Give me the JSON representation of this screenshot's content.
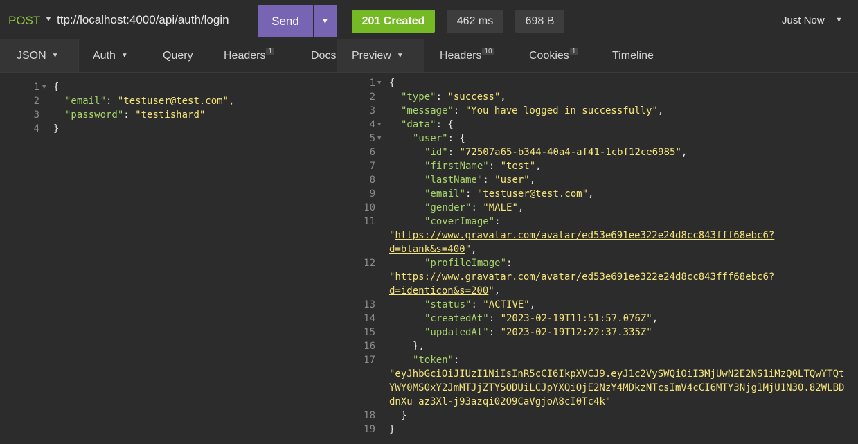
{
  "request": {
    "method": "POST",
    "url": "ttp://localhost:4000/api/auth/login",
    "send_label": "Send"
  },
  "response_meta": {
    "status": "201 Created",
    "time": "462 ms",
    "size": "698 B",
    "history_label": "Just Now"
  },
  "request_tabs": [
    {
      "label": "JSON"
    },
    {
      "label": "Auth"
    },
    {
      "label": "Query"
    },
    {
      "label": "Headers",
      "badge": "1"
    },
    {
      "label": "Docs"
    }
  ],
  "response_tabs": [
    {
      "label": "Preview"
    },
    {
      "label": "Headers",
      "badge": "10"
    },
    {
      "label": "Cookies",
      "badge": "1"
    },
    {
      "label": "Timeline"
    }
  ],
  "request_body": {
    "line_numbers": [
      "1",
      "2",
      "3",
      "4"
    ],
    "open": "{",
    "email_key": "\"email\"",
    "email_val": "\"testuser@test.com\"",
    "password_key": "\"password\"",
    "password_val": "\"testishard\"",
    "close": "}"
  },
  "response_body": {
    "line_numbers": [
      "1",
      "2",
      "3",
      "4",
      "5",
      "6",
      "7",
      "8",
      "9",
      "10",
      "11",
      "12",
      "13",
      "14",
      "15",
      "16",
      "17",
      "18",
      "19"
    ],
    "type_key": "\"type\"",
    "type_val": "\"success\"",
    "message_key": "\"message\"",
    "message_val": "\"You have logged in successfully\"",
    "data_key": "\"data\"",
    "user_key": "\"user\"",
    "id_key": "\"id\"",
    "id_val": "\"72507a65-b344-40a4-af41-1cbf12ce6985\"",
    "firstName_key": "\"firstName\"",
    "firstName_val": "\"test\"",
    "lastName_key": "\"lastName\"",
    "lastName_val": "\"user\"",
    "email_key": "\"email\"",
    "email_val": "\"testuser@test.com\"",
    "gender_key": "\"gender\"",
    "gender_val": "\"MALE\"",
    "coverImage_key": "\"coverImage\"",
    "coverImage_url_1": "https://www.gravatar.com/avatar/ed53e691ee322e24d8cc843fff68ebc6?",
    "coverImage_url_2": "d=blank&s=400",
    "profileImage_key": "\"profileImage\"",
    "profileImage_url_1": "https://www.gravatar.com/avatar/ed53e691ee322e24d8cc843fff68ebc6?",
    "profileImage_url_2": "d=identicon&s=200",
    "status_key": "\"status\"",
    "status_val": "\"ACTIVE\"",
    "createdAt_key": "\"createdAt\"",
    "createdAt_val": "\"2023-02-19T11:51:57.076Z\"",
    "updatedAt_key": "\"updatedAt\"",
    "updatedAt_val": "\"2023-02-19T12:22:37.335Z\"",
    "token_key": "\"token\"",
    "token_line_1": "\"eyJhbGciOiJIUzI1NiIsInR5cCI6IkpXVCJ9.eyJ1c2VySWQiOiI3MjUwN2E2NS1iMzQ0LTQwYTQt",
    "token_line_2": "YWY0MS0xY2JmMTJjZTY5ODUiLCJpYXQiOjE2NzY4MDkzNTcsImV4cCI6MTY3Njg1MjU1N30.82WLBD",
    "token_line_3": "dnXu_az3Xl-j93azqi02O9CaVgjoA8cI0Tc4k\""
  }
}
